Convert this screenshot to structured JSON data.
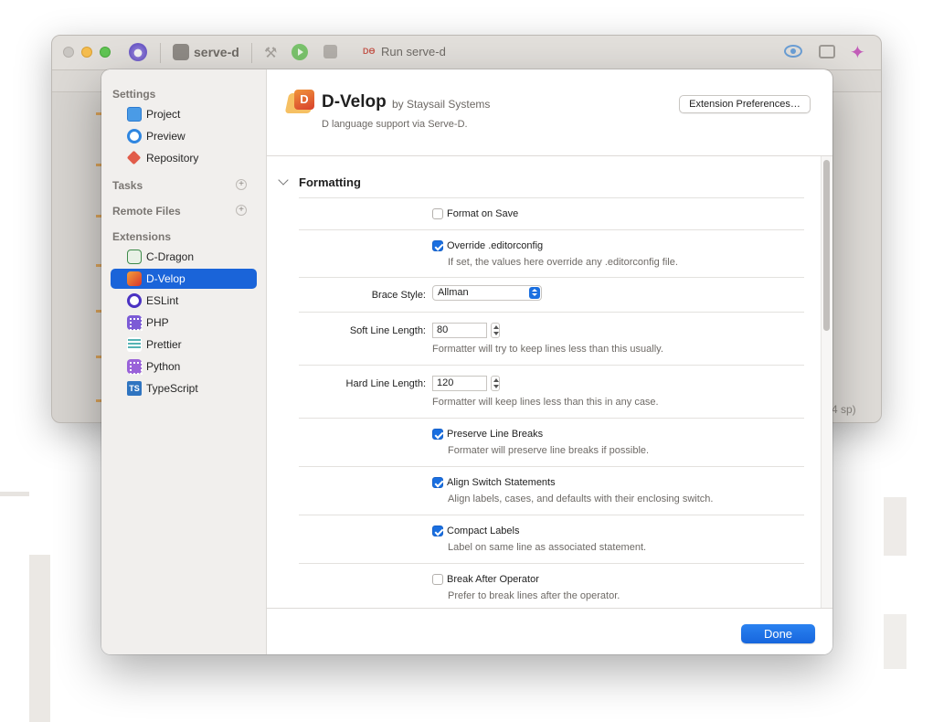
{
  "background_window": {
    "project_name": "serve-d",
    "run_tag": "DƟ",
    "run_label": "Run serve-d",
    "status_text": "4 sp)"
  },
  "sidebar": {
    "settings_header": "Settings",
    "settings_items": [
      {
        "label": "Project",
        "icon": "project-icon"
      },
      {
        "label": "Preview",
        "icon": "preview-eye-icon"
      },
      {
        "label": "Repository",
        "icon": "repository-icon"
      }
    ],
    "tasks_header": "Tasks",
    "remote_files_header": "Remote Files",
    "extensions_header": "Extensions",
    "extension_items": [
      {
        "label": "C-Dragon",
        "icon": "c-dragon-icon"
      },
      {
        "label": "D-Velop",
        "icon": "d-velop-icon",
        "selected": true
      },
      {
        "label": "ESLint",
        "icon": "eslint-icon"
      },
      {
        "label": "PHP",
        "icon": "php-icon"
      },
      {
        "label": "Prettier",
        "icon": "prettier-icon"
      },
      {
        "label": "Python",
        "icon": "python-icon"
      },
      {
        "label": "TypeScript",
        "icon": "typescript-icon",
        "badge": "TS"
      }
    ],
    "plus": "+"
  },
  "extension": {
    "title": "D-Velop",
    "author": "by Staysail Systems",
    "description": "D language support via Serve-D.",
    "logo_letter": "D",
    "preferences_button": "Extension Preferences…"
  },
  "section": {
    "title": "Formatting",
    "format_on_save": {
      "label": "Format on Save",
      "checked": false
    },
    "override_editorconfig": {
      "label": "Override .editorconfig",
      "checked": true,
      "desc": "If set, the values here override any .editorconfig file."
    },
    "brace_style": {
      "label": "Brace Style:",
      "value": "Allman"
    },
    "soft_line_length": {
      "label": "Soft Line Length:",
      "value": "80",
      "desc": "Formatter will try to keep lines less than this usually."
    },
    "hard_line_length": {
      "label": "Hard Line Length:",
      "value": "120",
      "desc": "Formatter will keep lines less than this in any case."
    },
    "preserve_line_breaks": {
      "label": "Preserve Line Breaks",
      "checked": true,
      "desc": "Formater will preserve line breaks if possible."
    },
    "align_switch": {
      "label": "Align Switch Statements",
      "checked": true,
      "desc": "Align labels, cases, and defaults with their enclosing switch."
    },
    "compact_labels": {
      "label": "Compact Labels",
      "checked": true,
      "desc": "Label on same line as associated statement."
    },
    "break_after_operator": {
      "label": "Break After Operator",
      "checked": false,
      "desc": "Prefer to break lines after the operator."
    }
  },
  "footer": {
    "done_button": "Done"
  },
  "colors": {
    "accent": "#1a64d9",
    "sidebar_bg": "#f1efed"
  }
}
